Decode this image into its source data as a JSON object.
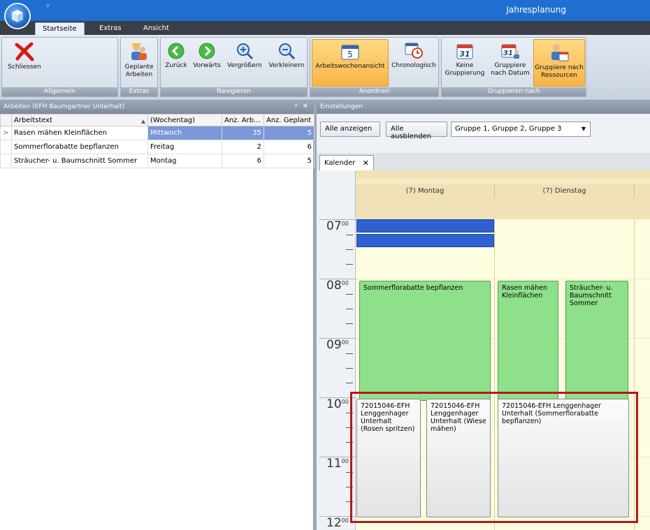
{
  "window": {
    "title": "Jahresplanung"
  },
  "ribbon": {
    "tabs": [
      {
        "label": "Startseite",
        "active": true
      },
      {
        "label": "Extras"
      },
      {
        "label": "Ansicht"
      }
    ],
    "groups": {
      "allgemein": {
        "label": "Allgemein",
        "close_label": "Schliessen"
      },
      "extras": {
        "label": "Extras",
        "planned_line1": "Geplante",
        "planned_line2": "Arbeiten"
      },
      "navigieren": {
        "label": "Navigieren",
        "back": "Zurück",
        "forward": "Vorwärts",
        "zoom_in": "Vergrößern",
        "zoom_out": "Verkleinern"
      },
      "anordnen": {
        "label": "Anordnen",
        "workweek": "Arbeitswochenansicht",
        "workweek_day": "5",
        "chrono": "Chronologisch"
      },
      "gruppieren": {
        "label": "Gruppieren nach",
        "none_line1": "Keine",
        "none_line2": "Gruppierung",
        "date_line1": "Gruppiere",
        "date_line2": "nach Datum",
        "res_line1": "Gruppiere nach",
        "res_line2": "Ressourcen",
        "cal_day_1": "31",
        "cal_day_2": "31"
      }
    }
  },
  "left_panel": {
    "title": "Arbeiten (EFH Baumgartner Unterhalt)",
    "pin": "ᵖ",
    "close": "✕",
    "columns": [
      "Arbeitstext",
      "(Wochentag)",
      "Anz. Arb...",
      "Anz. Geplant"
    ],
    "rows": [
      {
        "text": "Rasen mähen Kleinflächen",
        "day": "Mittwoch",
        "count": "35",
        "planned": "5",
        "selected": true
      },
      {
        "text": "Sommerflorabatte bepflanzen",
        "day": "Freitag",
        "count": "2",
        "planned": "6"
      },
      {
        "text": "Sträucher- u. Baumschnitt Sommer",
        "day": "Montag",
        "count": "6",
        "planned": "5"
      }
    ]
  },
  "settings": {
    "title": "Einstellungen",
    "show_all": "Alle anzeigen",
    "hide_all": "Alle ausblenden",
    "group_select_value": "Gruppe 1, Gruppe 2, Gruppe 3"
  },
  "calendar": {
    "tab_label": "Kalender",
    "tab_close": "✕",
    "days": [
      "(7) Montag",
      "(7) Dienstag"
    ],
    "hours": [
      {
        "h": "07",
        "m": "00"
      },
      {
        "h": "08",
        "m": "00"
      },
      {
        "h": "09",
        "m": "00"
      },
      {
        "h": "10",
        "m": "00"
      },
      {
        "h": "11",
        "m": "00"
      },
      {
        "h": "12",
        "m": "00"
      }
    ],
    "events": {
      "sommerflor": "Sommerflorabatte bepflanzen",
      "rasen": "Rasen mähen Kleinflächen",
      "straeucher": "Sträucher- u. Baumschnitt Sommer",
      "rosen": "72015046-EFH Lenggenhager Unterhalt (Rosen spritzen)",
      "wiese": "72015046-EFH Lenggenhager Unterhalt (Wiese mähen)",
      "sommerflor2": "72015046-EFH Lenggenhager Unterhalt (Sommerflorabatte bepflanzen)"
    }
  },
  "colors": {
    "accent": "#1e6fd0",
    "event_green": "#8ee08a",
    "highlight": "#b21a1a",
    "selection": "#7c97d9"
  }
}
